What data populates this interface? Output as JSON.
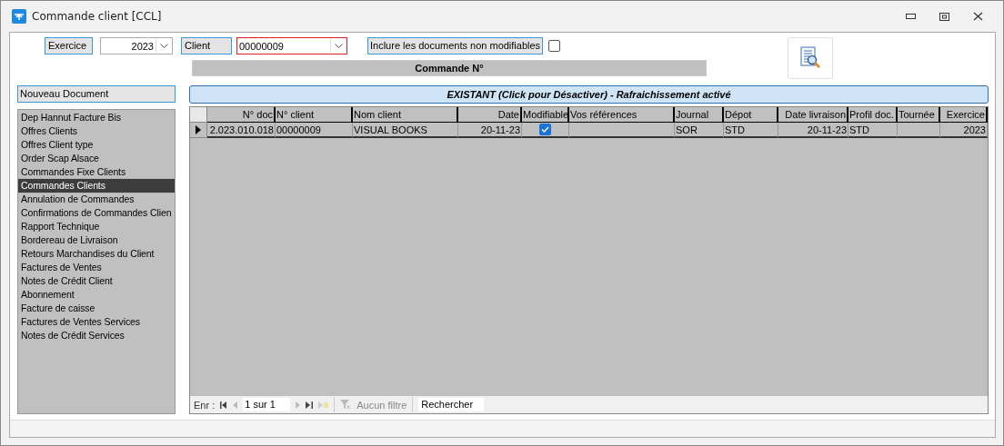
{
  "window": {
    "title": "Commande client [CCL]"
  },
  "filters": {
    "exercice_label": "Exercice",
    "exercice_value": "2023",
    "client_label": "Client",
    "client_value": "00000009",
    "include_label": "Inclure les documents non modifiables",
    "include_checked": false,
    "commande_label": "Commande N°"
  },
  "sidebar": {
    "header": "Nouveau Document",
    "items": [
      {
        "label": "Dep Hannut Facture Bis",
        "selected": false
      },
      {
        "label": "Offres Clients",
        "selected": false
      },
      {
        "label": "Offres Client type",
        "selected": false
      },
      {
        "label": "Order Scap Alsace",
        "selected": false
      },
      {
        "label": "Commandes Fixe Clients",
        "selected": false
      },
      {
        "label": "Commandes Clients",
        "selected": true
      },
      {
        "label": "Annulation de Commandes",
        "selected": false
      },
      {
        "label": "Confirmations de Commandes Clien",
        "selected": false
      },
      {
        "label": "Rapport Technique",
        "selected": false
      },
      {
        "label": "Bordereau de Livraison",
        "selected": false
      },
      {
        "label": "Retours Marchandises du Client",
        "selected": false
      },
      {
        "label": "Factures de Ventes",
        "selected": false
      },
      {
        "label": "Notes de Crédit Client",
        "selected": false
      },
      {
        "label": "Abonnement",
        "selected": false
      },
      {
        "label": "Facture de caisse",
        "selected": false
      },
      {
        "label": "Factures de Ventes Services",
        "selected": false
      },
      {
        "label": "Notes de Crédit Services",
        "selected": false
      }
    ]
  },
  "banner": "EXISTANT (Click pour Désactiver) - Rafraichissement activé",
  "table": {
    "columns": [
      "N° doc",
      "N° client",
      "Nom client",
      "Date",
      "Modifiable",
      "Vos références",
      "Journal",
      "Dépot",
      "Date livraison",
      "Profil doc.",
      "Tournée",
      "Exercice"
    ],
    "rows": [
      {
        "selected": true,
        "cells": [
          {
            "kind": "text",
            "text": "2.023.010.018"
          },
          {
            "kind": "text",
            "text": "00000009"
          },
          {
            "kind": "text",
            "text": "VISUAL BOOKS"
          },
          {
            "kind": "text",
            "text": "20-11-23"
          },
          {
            "kind": "check",
            "checked": true
          },
          {
            "kind": "empty"
          },
          {
            "kind": "text",
            "text": "SOR"
          },
          {
            "kind": "text",
            "text": "STD"
          },
          {
            "kind": "text",
            "text": "20-11-23"
          },
          {
            "kind": "text",
            "text": "STD"
          },
          {
            "kind": "empty"
          },
          {
            "kind": "text",
            "text": "2023"
          }
        ]
      }
    ]
  },
  "navigator": {
    "label": "Enr :",
    "position": "1 sur 1",
    "filter": "Aucun filtre",
    "search": "Rechercher"
  }
}
